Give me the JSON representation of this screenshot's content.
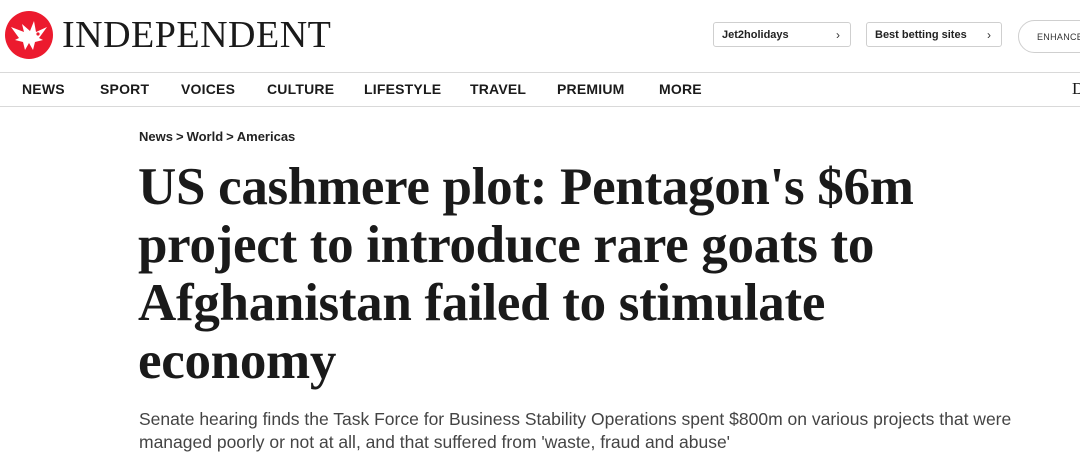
{
  "brand": {
    "name": "INDEPENDENT",
    "accent": "#ec1a2e"
  },
  "promos": [
    {
      "label": "Jet2holidays",
      "chevron": "›"
    },
    {
      "label": "Best betting sites",
      "chevron": "›"
    }
  ],
  "enhance_label": "ENHANCE",
  "nav": {
    "items": [
      "NEWS",
      "SPORT",
      "VOICES",
      "CULTURE",
      "LIFESTYLE",
      "TRAVEL",
      "PREMIUM",
      "MORE"
    ],
    "edge_glyph": "D"
  },
  "breadcrumb": {
    "items": [
      "News",
      "World",
      "Americas"
    ],
    "separator": ">"
  },
  "article": {
    "headline": "US cashmere plot: Pentagon's $6m project to introduce rare goats to Afghanistan failed to stimulate economy",
    "standfirst": "Senate hearing finds the Task Force for Business Stability Operations spent $800m on various projects that were managed poorly or not at all, and that suffered from 'waste, fraud and abuse'"
  }
}
